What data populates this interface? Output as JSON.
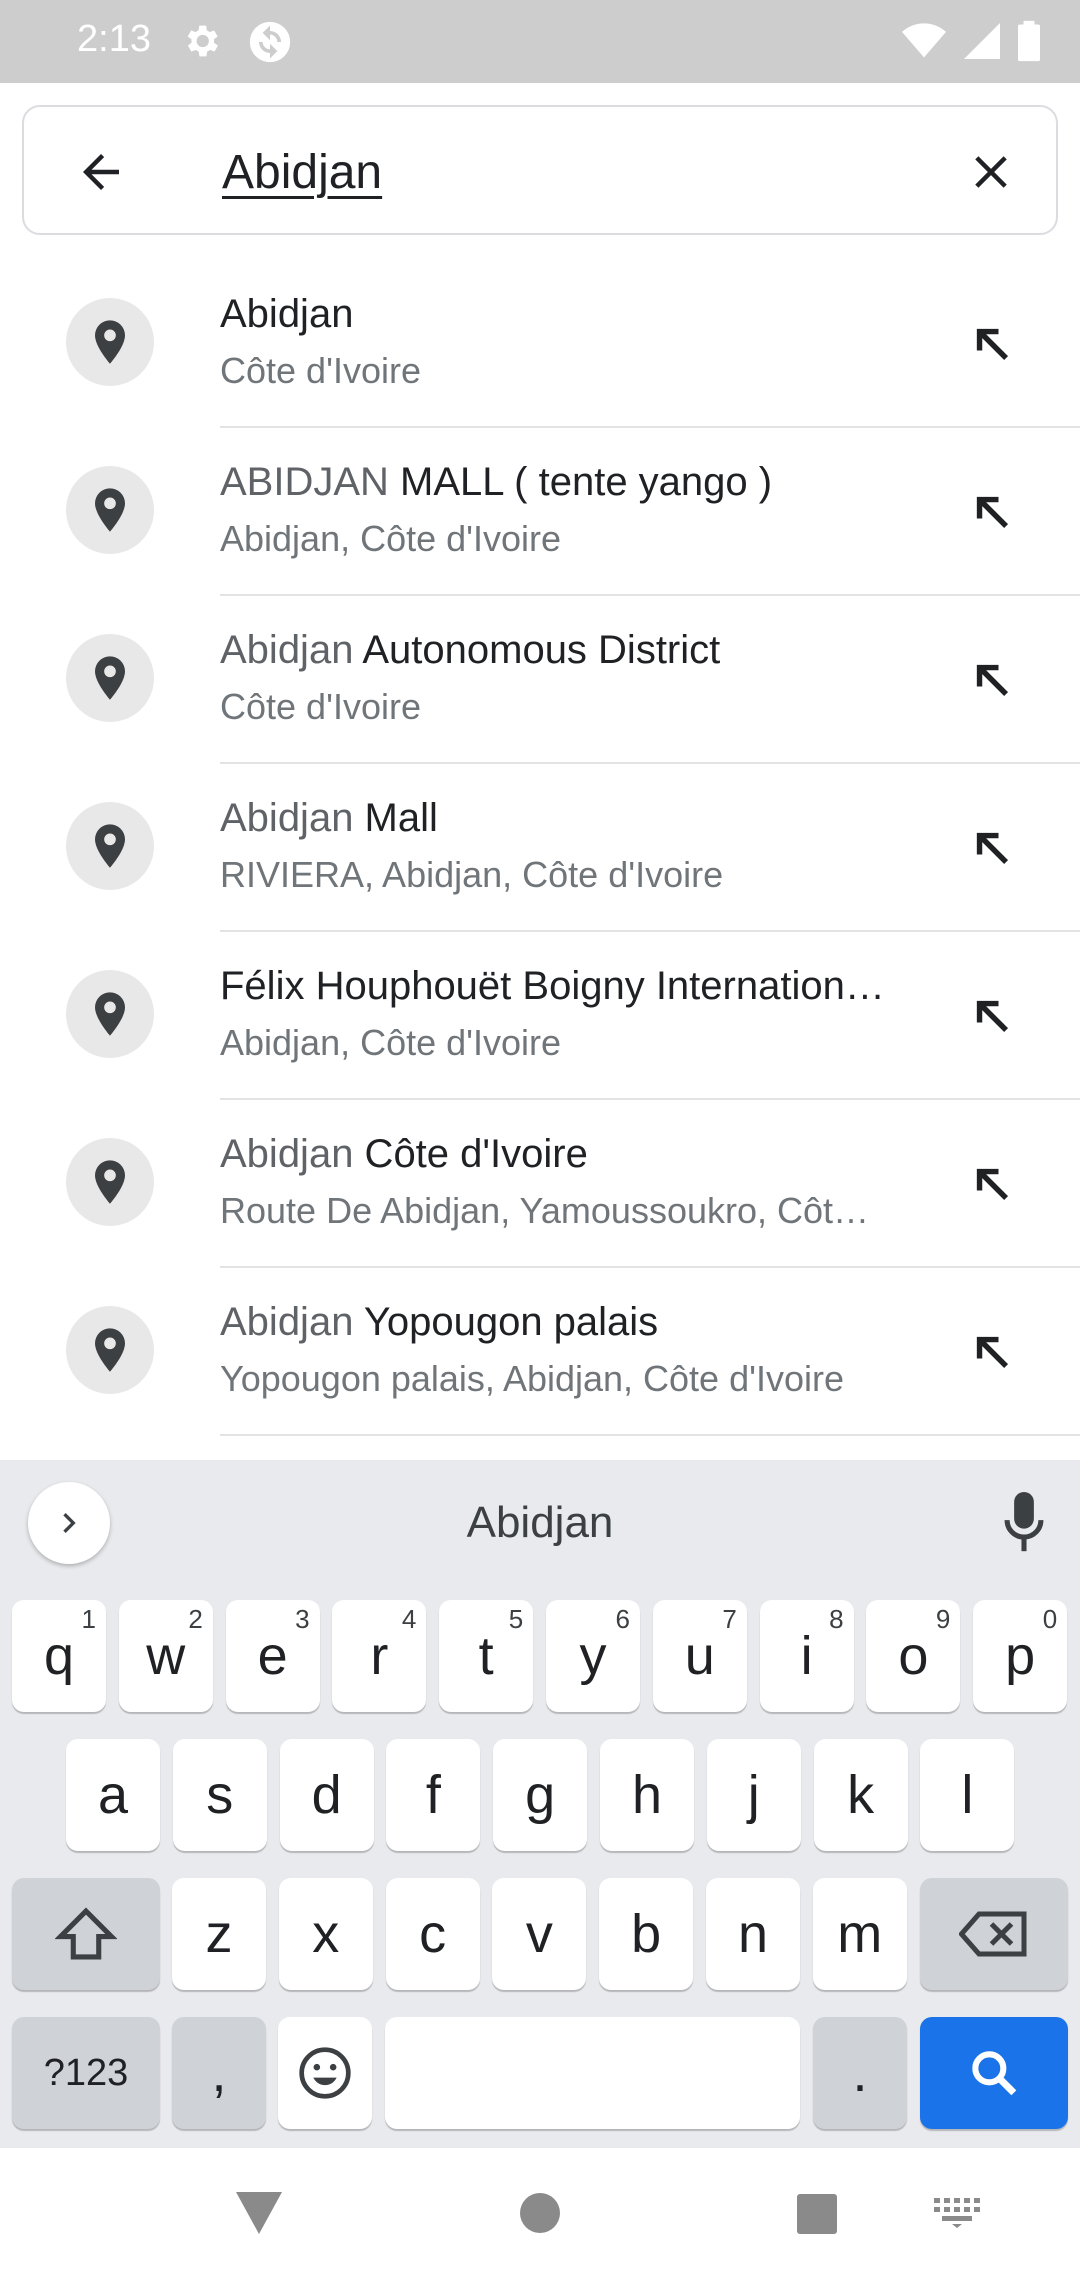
{
  "status_bar": {
    "time": "2:13",
    "left_icons": [
      "gear-icon",
      "sync-icon"
    ],
    "right_icons": [
      "wifi-icon",
      "signal-icon",
      "battery-icon"
    ]
  },
  "search": {
    "query": "Abidjan",
    "back_icon": "arrow-left-icon",
    "clear_icon": "close-icon"
  },
  "results": [
    {
      "title_match": "Abidjan",
      "title_rest": "",
      "subtitle": "Côte d'Ivoire",
      "all_bold": true
    },
    {
      "title_match": "ABIDJAN",
      "title_rest": " MALL ( tente yango )",
      "subtitle": "Abidjan, Côte d'Ivoire"
    },
    {
      "title_match": "Abidjan",
      "title_rest": " Autonomous District",
      "subtitle": "Côte d'Ivoire"
    },
    {
      "title_match": "Abidjan",
      "title_rest": " Mall",
      "subtitle": "RIVIERA, Abidjan, Côte d'Ivoire"
    },
    {
      "title_match": "",
      "title_rest": "Félix Houphouët Boigny Internation…",
      "subtitle": "Abidjan, Côte d'Ivoire"
    },
    {
      "title_match": "Abidjan",
      "title_rest": " Côte d'Ivoire",
      "subtitle": "Route De Abidjan, Yamoussoukro, Côt…"
    },
    {
      "title_match": "Abidjan",
      "title_rest": " Yopougon palais",
      "subtitle": "Yopougon palais, Abidjan, Côte d'Ivoire"
    }
  ],
  "keyboard": {
    "suggestion": "Abidjan",
    "row1": [
      {
        "k": "q",
        "h": "1"
      },
      {
        "k": "w",
        "h": "2"
      },
      {
        "k": "e",
        "h": "3"
      },
      {
        "k": "r",
        "h": "4"
      },
      {
        "k": "t",
        "h": "5"
      },
      {
        "k": "y",
        "h": "6"
      },
      {
        "k": "u",
        "h": "7"
      },
      {
        "k": "i",
        "h": "8"
      },
      {
        "k": "o",
        "h": "9"
      },
      {
        "k": "p",
        "h": "0"
      }
    ],
    "row2": [
      "a",
      "s",
      "d",
      "f",
      "g",
      "h",
      "j",
      "k",
      "l"
    ],
    "row3": [
      "z",
      "x",
      "c",
      "v",
      "b",
      "n",
      "m"
    ],
    "symbols_label": "?123",
    "comma_label": ",",
    "period_label": "."
  },
  "colors": {
    "accent": "#1a73e8",
    "status_bar": "#cdcdcd",
    "keyboard_bg": "#e8eaed"
  }
}
